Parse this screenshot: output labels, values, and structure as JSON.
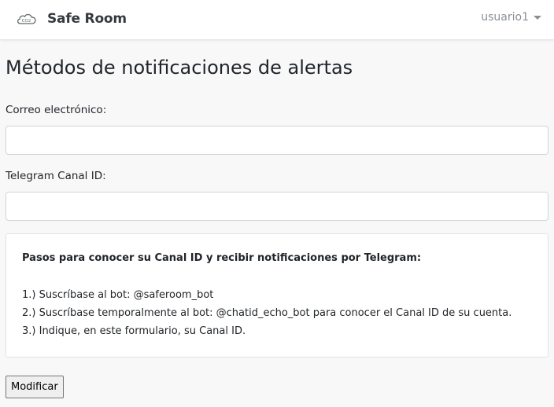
{
  "navbar": {
    "brand_name": "Safe Room",
    "logo_icon": "co2-cloud-icon",
    "logo_text": "CO2",
    "user_name": "usuario1"
  },
  "page": {
    "title": "Métodos de notificaciones de alertas"
  },
  "form": {
    "email_label": "Correo electrónico:",
    "email_value": "",
    "telegram_label": "Telegram Canal ID:",
    "telegram_value": "",
    "submit_label": "Modificar"
  },
  "info": {
    "heading": "Pasos para conocer su Canal ID y recibir notificaciones por Telegram:",
    "steps": [
      "1.) Suscríbase al bot: @saferoom_bot",
      "2.) Suscríbase temporalmente al bot: @chatid_echo_bot para conocer el Canal ID de su cuenta.",
      "3.) Indique, en este formulario, su Canal ID."
    ]
  },
  "colors": {
    "page_background": "#f8f8f9",
    "navbar_background": "#ffffff",
    "input_border": "#ced4da",
    "muted_text": "#8a9096"
  }
}
